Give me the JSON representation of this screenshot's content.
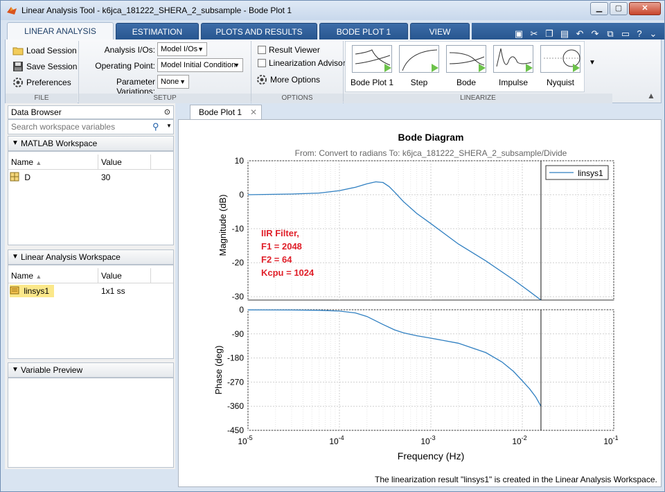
{
  "window": {
    "title": "Linear Analysis Tool - k6jca_181222_SHERA_2_subsample - Bode Plot 1",
    "controls": {
      "minimize": "▁",
      "maximize": "▢",
      "close": "✕"
    }
  },
  "tabs": [
    {
      "label": "LINEAR ANALYSIS",
      "active": true
    },
    {
      "label": "ESTIMATION",
      "active": false
    },
    {
      "label": "PLOTS AND RESULTS",
      "active": false
    },
    {
      "label": "BODE PLOT 1",
      "active": false
    },
    {
      "label": "VIEW",
      "active": false
    }
  ],
  "ribbon": {
    "file": {
      "load": "Load Session",
      "save": "Save Session",
      "prefs": "Preferences",
      "group": "FILE"
    },
    "setup": {
      "analysis_ios_label": "Analysis I/Os:",
      "analysis_ios_value": "Model I/Os",
      "operating_point_label": "Operating Point:",
      "operating_point_value": "Model Initial Condition",
      "param_var_label": "Parameter Variations:",
      "param_var_value": "None",
      "group": "SETUP"
    },
    "options": {
      "result_viewer": "Result Viewer",
      "linearization_advisor": "Linearization Advisor",
      "more_options": "More Options",
      "group": "OPTIONS"
    },
    "linearize": {
      "items": [
        "Bode Plot 1",
        "Step",
        "Bode",
        "Impulse",
        "Nyquist"
      ],
      "group": "LINEARIZE"
    }
  },
  "data_browser": {
    "title": "Data Browser",
    "search_placeholder": "Search workspace variables",
    "matlab_ws": {
      "title": "MATLAB Workspace",
      "col_name": "Name",
      "col_value": "Value",
      "rows": [
        {
          "name": "D",
          "value": "30"
        }
      ]
    },
    "linear_ws": {
      "title": "Linear Analysis Workspace",
      "col_name": "Name",
      "col_value": "Value",
      "rows": [
        {
          "name": "linsys1",
          "value": "1x1 ss"
        }
      ]
    },
    "preview": {
      "title": "Variable Preview"
    }
  },
  "doc_tab": {
    "label": "Bode Plot 1"
  },
  "status": "The linearization result \"linsys1\" is created in the Linear Analysis Workspace.",
  "annotation": [
    "IIR Filter,",
    "F1 = 2048",
    "F2 = 64",
    "Kcpu = 1024"
  ],
  "chart_data": {
    "type": "line",
    "title": "Bode Diagram",
    "subtitle": "From: Convert to radians  To: k6jca_181222_SHERA_2_subsample/Divide",
    "xlabel": "Frequency  (Hz)",
    "xscale": "log",
    "xlim": [
      1e-05,
      0.1
    ],
    "x_ticks": [
      1e-05,
      0.0001,
      0.001,
      0.01,
      0.1
    ],
    "x_tick_labels": [
      "10^-5",
      "10^-4",
      "10^-3",
      "10^-2",
      "10^-1"
    ],
    "legend": {
      "entries": [
        "linsys1"
      ],
      "placement": "top-right"
    },
    "grid": true,
    "nyquist_hz": 0.016,
    "magnitude": {
      "ylabel": "Magnitude (dB)",
      "ylim": [
        -31,
        10
      ],
      "y_ticks": [
        10,
        0,
        -10,
        -20,
        -30
      ],
      "series": [
        {
          "name": "linsys1",
          "color": "#2f7fc1",
          "x": [
            1e-05,
            3e-05,
            6e-05,
            0.0001,
            0.00015,
            0.0002,
            0.00025,
            0.0003,
            0.00035,
            0.0004,
            0.0005,
            0.0007,
            0.001,
            0.002,
            0.004,
            0.008,
            0.012,
            0.016
          ],
          "y": [
            0,
            0.2,
            0.5,
            1.2,
            2.2,
            3.2,
            3.8,
            3.6,
            2.4,
            0.8,
            -2.0,
            -5.5,
            -8.5,
            -14.5,
            -19.5,
            -25.0,
            -28.5,
            -31.0
          ]
        }
      ]
    },
    "phase": {
      "ylabel": "Phase (deg)",
      "ylim": [
        -450,
        0
      ],
      "y_ticks": [
        0,
        -90,
        -180,
        -270,
        -360,
        -450
      ],
      "series": [
        {
          "name": "linsys1",
          "color": "#2f7fc1",
          "x": [
            1e-05,
            3e-05,
            6e-05,
            0.0001,
            0.00015,
            0.0002,
            0.0003,
            0.0004,
            0.0005,
            0.0007,
            0.001,
            0.002,
            0.004,
            0.006,
            0.008,
            0.01,
            0.012,
            0.014,
            0.016
          ],
          "y": [
            -0.5,
            -1,
            -2,
            -5,
            -12,
            -25,
            -55,
            -75,
            -86,
            -97,
            -106,
            -125,
            -160,
            -195,
            -230,
            -265,
            -295,
            -325,
            -360
          ]
        }
      ]
    }
  }
}
